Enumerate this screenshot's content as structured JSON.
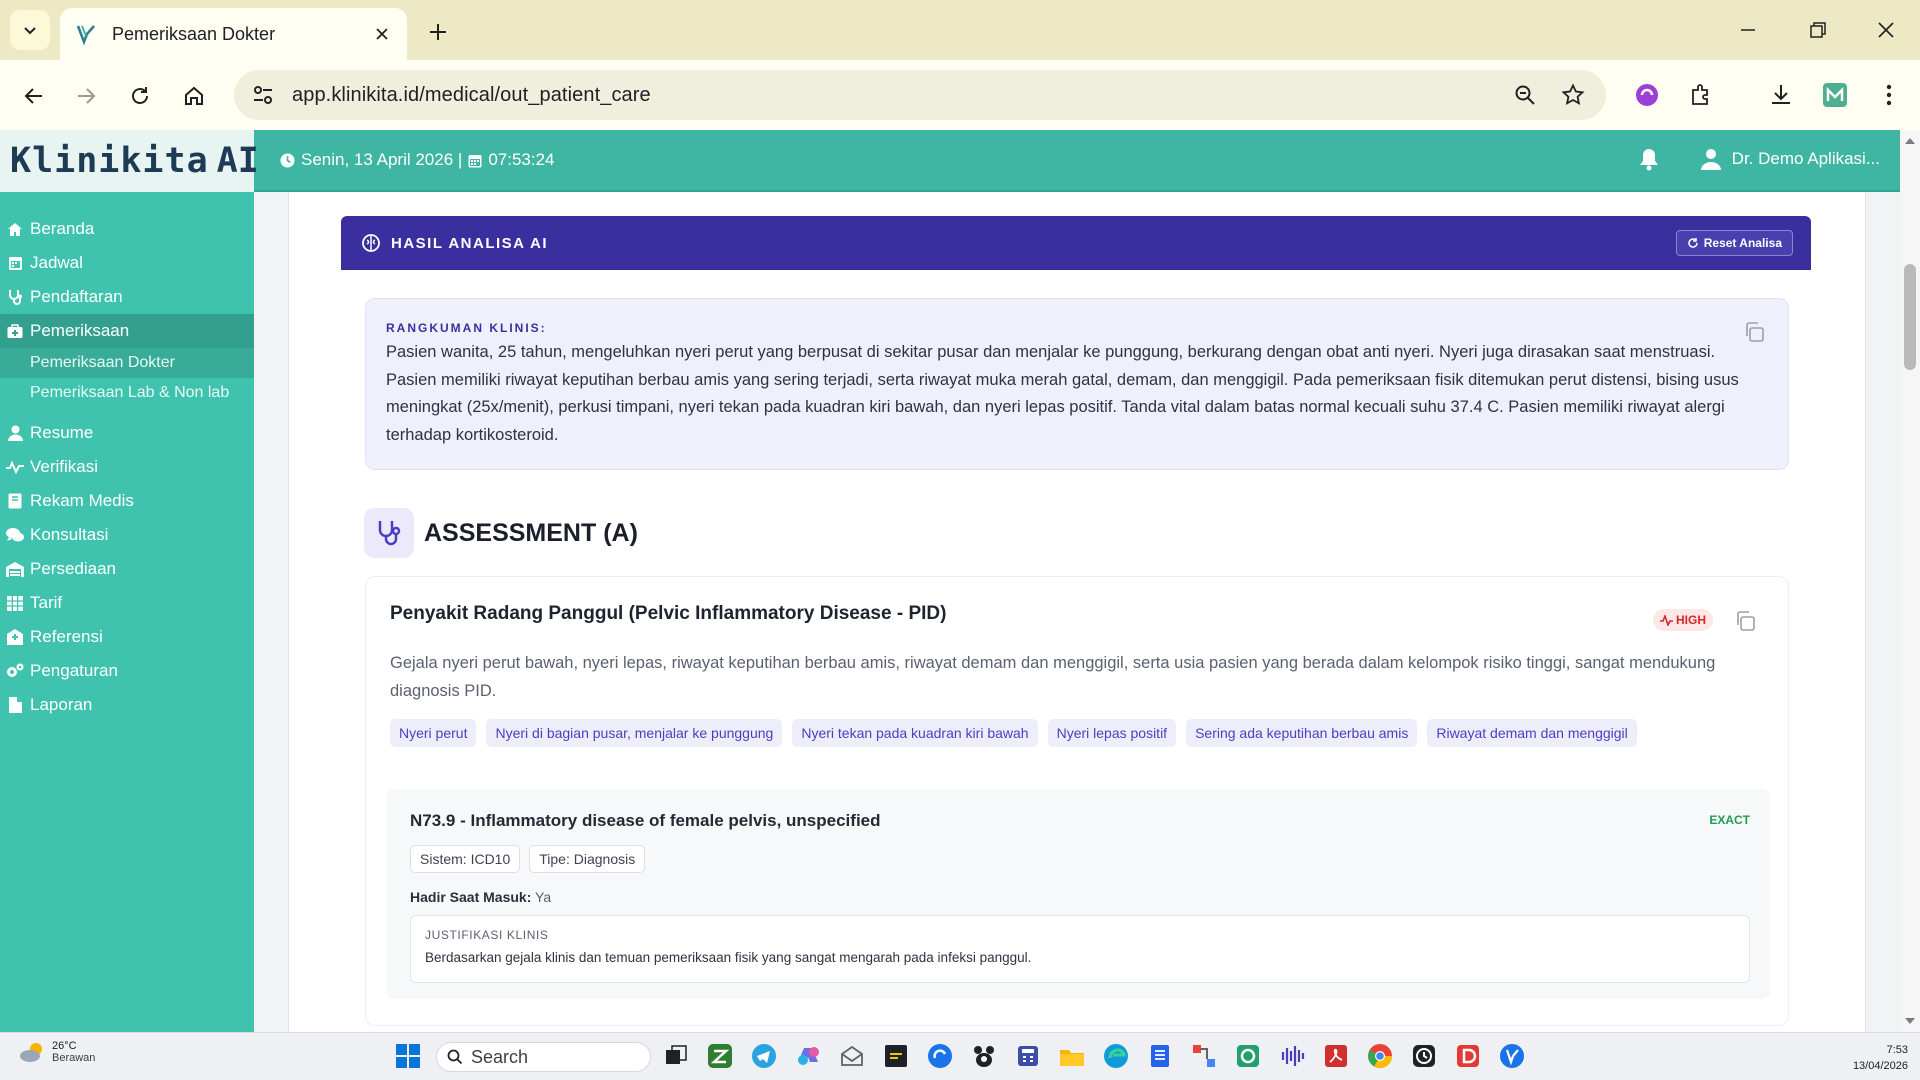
{
  "browser": {
    "tab_title": "Pemeriksaan Dokter",
    "url": "app.klinikita.id/medical/out_patient_care",
    "new_tab_label": "+"
  },
  "header": {
    "logo_text": "Klinikita",
    "logo_ai": "AI",
    "datetime": "Senin, 13 April 2026 | 📅 07:53:24",
    "date": "Senin, 13 April 2026 |",
    "time": "07:53:24",
    "user": "Dr. Demo Aplikasi..."
  },
  "sidebar": {
    "items": [
      {
        "label": "Beranda",
        "icon": "home-icon"
      },
      {
        "label": "Jadwal",
        "icon": "calendar-icon"
      },
      {
        "label": "Pendaftaran",
        "icon": "stethoscope-icon"
      },
      {
        "label": "Pemeriksaan",
        "icon": "medkit-icon"
      },
      {
        "label": "Resume",
        "icon": "user-icon"
      },
      {
        "label": "Verifikasi",
        "icon": "pulse-icon"
      },
      {
        "label": "Rekam Medis",
        "icon": "book-icon"
      },
      {
        "label": "Konsultasi",
        "icon": "chat-icon"
      },
      {
        "label": "Persediaan",
        "icon": "warehouse-icon"
      },
      {
        "label": "Tarif",
        "icon": "table-icon"
      },
      {
        "label": "Referensi",
        "icon": "building-icon"
      },
      {
        "label": "Pengaturan",
        "icon": "gears-icon"
      },
      {
        "label": "Laporan",
        "icon": "file-icon"
      }
    ],
    "sub_items": [
      "Pemeriksaan Dokter",
      "Pemeriksaan Lab & Non lab"
    ]
  },
  "ai_panel": {
    "title": "HASIL ANALISA AI",
    "reset_label": "Reset Analisa",
    "summary_label": "RANGKUMAN KLINIS:",
    "summary_text": "Pasien wanita, 25 tahun, mengeluhkan nyeri perut yang berpusat di sekitar pusar dan menjalar ke punggung, berkurang dengan obat anti nyeri. Nyeri juga dirasakan saat menstruasi. Pasien memiliki riwayat keputihan berbau amis yang sering terjadi, serta riwayat muka merah gatal, demam, dan menggigil. Pada pemeriksaan fisik ditemukan perut distensi, bising usus meningkat (25x/menit), perkusi timpani, nyeri tekan pada kuadran kiri bawah, dan nyeri lepas positif. Tanda vital dalam batas normal kecuali suhu 37.4 C. Pasien memiliki riwayat alergi terhadap kortikosteroid."
  },
  "assessment": {
    "title": "ASSESSMENT (A)",
    "diagnosis": "Penyakit Radang Panggul (Pelvic Inflammatory Disease - PID)",
    "risk": "HIGH",
    "description": "Gejala nyeri perut bawah, nyeri lepas, riwayat keputihan berbau amis, riwayat demam dan menggigil, serta usia pasien yang berada dalam kelompok risiko tinggi, sangat mendukung diagnosis PID.",
    "tags": [
      "Nyeri perut",
      "Nyeri di bagian pusar, menjalar ke punggung",
      "Nyeri tekan pada kuadran kiri bawah",
      "Nyeri lepas positif",
      "Sering ada keputihan berbau amis",
      "Riwayat demam dan menggigil"
    ],
    "icd": {
      "code": "N73.9 - Inflammatory disease of female pelvis, unspecified",
      "match": "EXACT",
      "system": "Sistem: ICD10",
      "type": "Tipe: Diagnosis",
      "hadir_label": "Hadir Saat Masuk:",
      "hadir_value": "Ya",
      "justification_label": "JUSTIFIKASI KLINIS",
      "justification_text": "Berdasarkan gejala klinis dan temuan pemeriksaan fisik yang sangat mengarah pada infeksi panggul."
    }
  },
  "taskbar": {
    "weather_temp": "26°C",
    "weather_desc": "Berawan",
    "search": "Search",
    "time": "7:53",
    "date": "13/04/2026"
  },
  "colors": {
    "teal": "#3fb5a3",
    "sidebar": "#3fc2ae",
    "ai_bar": "#3b2fa0",
    "risk_high": "#d62828",
    "exact": "#1f9d55"
  }
}
